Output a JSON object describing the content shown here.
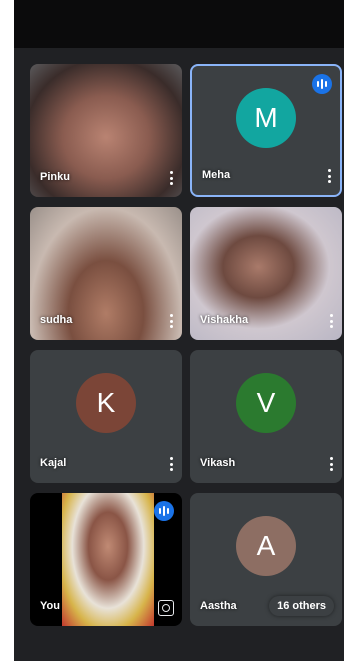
{
  "participants": [
    {
      "name": "Pinku",
      "initial": "",
      "avatar_color": "",
      "video": true
    },
    {
      "name": "Meha",
      "initial": "M",
      "avatar_color": "#12a6a0",
      "video": false,
      "speaking": true
    },
    {
      "name": "sudha",
      "initial": "",
      "avatar_color": "",
      "video": true
    },
    {
      "name": "Vishakha",
      "initial": "",
      "avatar_color": "",
      "video": true
    },
    {
      "name": "Kajal",
      "initial": "K",
      "avatar_color": "#7b4537",
      "video": false
    },
    {
      "name": "Vikash",
      "initial": "V",
      "avatar_color": "#2b7a2f",
      "video": false
    },
    {
      "name": "You",
      "initial": "",
      "avatar_color": "",
      "video": true,
      "self": true
    },
    {
      "name": "Aastha",
      "initial": "A",
      "avatar_color": "#8d6e63",
      "video": false
    }
  ],
  "others_badge": "16 others",
  "colors": {
    "speaking_border": "#8ab4f8",
    "accent": "#1a73e8",
    "tile_bg": "#3c4043",
    "app_bg": "#202124"
  }
}
